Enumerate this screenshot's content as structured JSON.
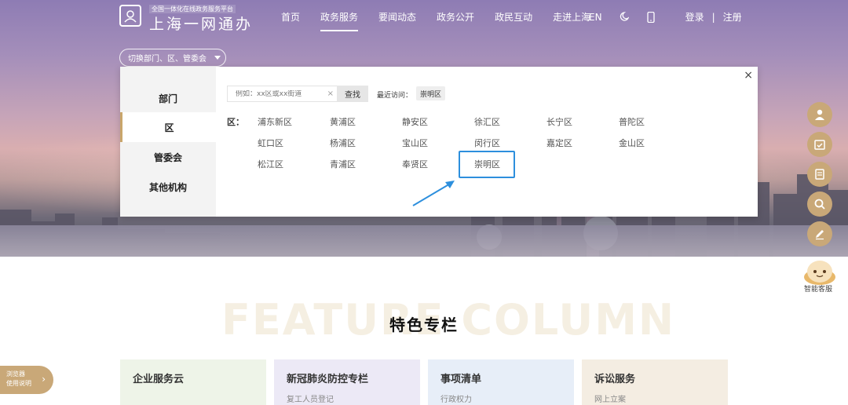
{
  "header": {
    "logo_small": "全国一体化在线政务服务平台",
    "logo_big": "上海一网通办",
    "nav": [
      "首页",
      "政务服务",
      "要闻动态",
      "政务公开",
      "政民互动",
      "走进上海"
    ],
    "lang": "EN",
    "login": "登录",
    "separator": "|",
    "register": "注册"
  },
  "switcher": {
    "label": "切换部门、区、管委会"
  },
  "panel": {
    "side_items": [
      "部门",
      "区",
      "管委会",
      "其他机构"
    ],
    "search_placeholder": "例如：xx区或xx街道",
    "search_clear": "×",
    "search_button": "查找",
    "recent_label": "最近访问：",
    "recent_item": "崇明区",
    "districts_label": "区：",
    "districts": [
      "浦东新区",
      "黄浦区",
      "静安区",
      "徐汇区",
      "长宁区",
      "普陀区",
      "虹口区",
      "杨浦区",
      "宝山区",
      "闵行区",
      "嘉定区",
      "金山区",
      "松江区",
      "青浦区",
      "奉贤区",
      "崇明区"
    ],
    "close": "×"
  },
  "robot_label": "智能客服",
  "feature": {
    "bg_word": "FEATURE COLUMN",
    "title": "特色专栏",
    "cards": [
      {
        "title": "企业服务云",
        "sub": "",
        "bg": "#eef4e8"
      },
      {
        "title": "新冠肺炎防控专栏",
        "sub": "复工人员登记",
        "bg": "#ece9f6"
      },
      {
        "title": "事项清单",
        "sub": "行政权力",
        "bg": "#e7eef8"
      },
      {
        "title": "诉讼服务",
        "sub": "网上立案",
        "bg": "#f4ede2"
      }
    ]
  },
  "side_tab": {
    "line1": "浏览器",
    "line2": "使用说明",
    "chev": "›"
  },
  "colors": {
    "accent": "#c9a878",
    "highlight": "#2d8fdd"
  }
}
